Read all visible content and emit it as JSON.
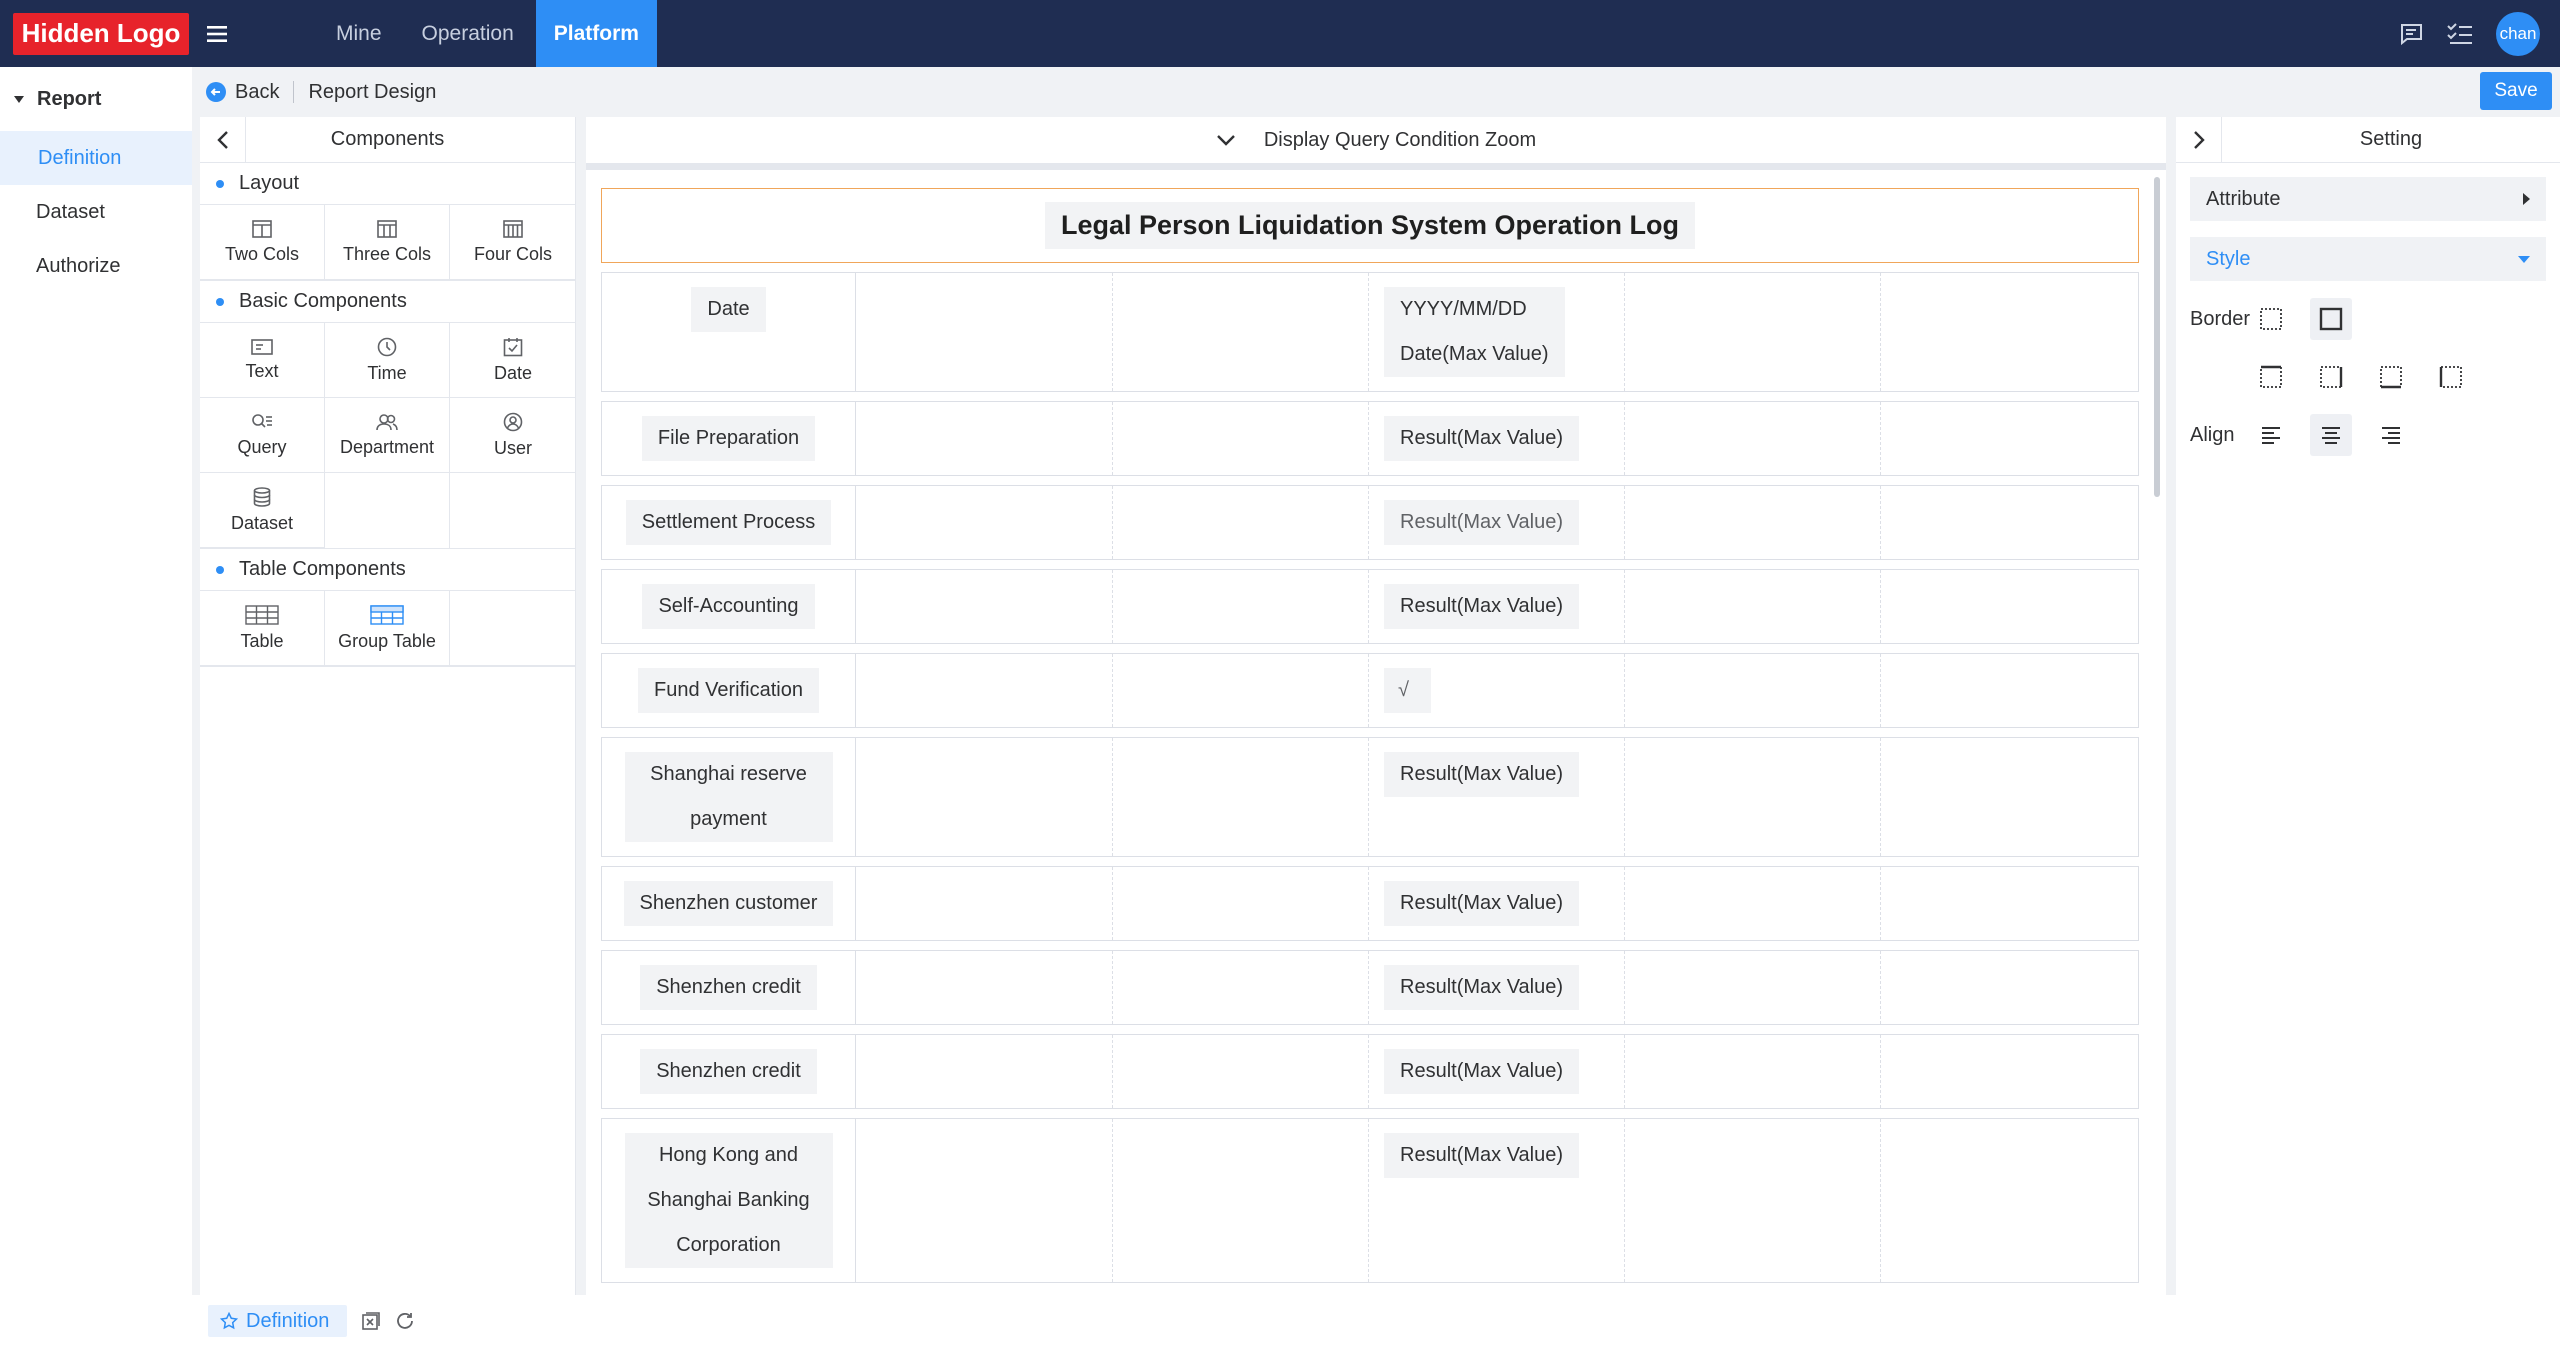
{
  "app": {
    "logo": "Hidden Logo"
  },
  "nav": {
    "tabs": [
      {
        "label": "Mine"
      },
      {
        "label": "Operation"
      },
      {
        "label": "Platform"
      }
    ],
    "active": "Platform"
  },
  "user": {
    "avatar": "chan"
  },
  "sidebar": {
    "header": "Report",
    "items": [
      {
        "label": "Definition"
      },
      {
        "label": "Dataset"
      },
      {
        "label": "Authorize"
      }
    ]
  },
  "breadcrumb": {
    "back": "Back",
    "title": "Report Design"
  },
  "toolbar": {
    "save_label": "Save"
  },
  "components": {
    "title": "Components",
    "sections": [
      {
        "title": "Layout",
        "items": [
          {
            "label": "Two Cols",
            "icon": "two-cols-icon"
          },
          {
            "label": "Three Cols",
            "icon": "three-cols-icon"
          },
          {
            "label": "Four Cols",
            "icon": "four-cols-icon"
          }
        ]
      },
      {
        "title": "Basic Components",
        "items": [
          {
            "label": "Text",
            "icon": "text-icon"
          },
          {
            "label": "Time",
            "icon": "clock-icon"
          },
          {
            "label": "Date",
            "icon": "calendar-icon"
          },
          {
            "label": "Query",
            "icon": "query-icon"
          },
          {
            "label": "Department",
            "icon": "department-icon"
          },
          {
            "label": "User",
            "icon": "user-icon"
          },
          {
            "label": "Dataset",
            "icon": "database-icon"
          }
        ]
      },
      {
        "title": "Table Components",
        "items": [
          {
            "label": "Table",
            "icon": "table-icon"
          },
          {
            "label": "Group Table",
            "icon": "group-table-icon"
          }
        ]
      }
    ]
  },
  "canvas": {
    "header": "Display Query Condition Zoom",
    "report_title": "Legal Person Liquidation System Operation Log",
    "rows": [
      {
        "label": "Date",
        "values": [
          "YYYY/MM/DD",
          "Date(Max Value)"
        ]
      },
      {
        "label": "File Preparation",
        "values": [
          "Result(Max Value)"
        ]
      },
      {
        "label": "Settlement Process",
        "values": [
          "Result(Max Value)"
        ]
      },
      {
        "label": "Self-Accounting",
        "values": [
          "Result(Max Value)"
        ]
      },
      {
        "label": "Fund Verification",
        "values": [
          "√"
        ]
      },
      {
        "label": "Shanghai reserve payment",
        "values": [
          "Result(Max Value)"
        ]
      },
      {
        "label": "Shenzhen customer",
        "values": [
          "Result(Max Value)"
        ]
      },
      {
        "label": "Shenzhen credit",
        "values": [
          "Result(Max Value)"
        ]
      },
      {
        "label": "Shenzhen credit",
        "values": [
          "Result(Max Value)"
        ]
      },
      {
        "label": "Hong Kong and Shanghai Banking Corporation",
        "values": [
          "Result(Max Value)"
        ]
      }
    ]
  },
  "setting": {
    "title": "Setting",
    "attribute_label": "Attribute",
    "style_label": "Style",
    "border_label": "Border",
    "align_label": "Align"
  },
  "footer": {
    "tab_label": "Definition"
  },
  "colors": {
    "topbar": "#1f2d52",
    "accent": "#2e8ef5",
    "logo_bg": "#e7232b",
    "title_border": "#f0a65a"
  }
}
